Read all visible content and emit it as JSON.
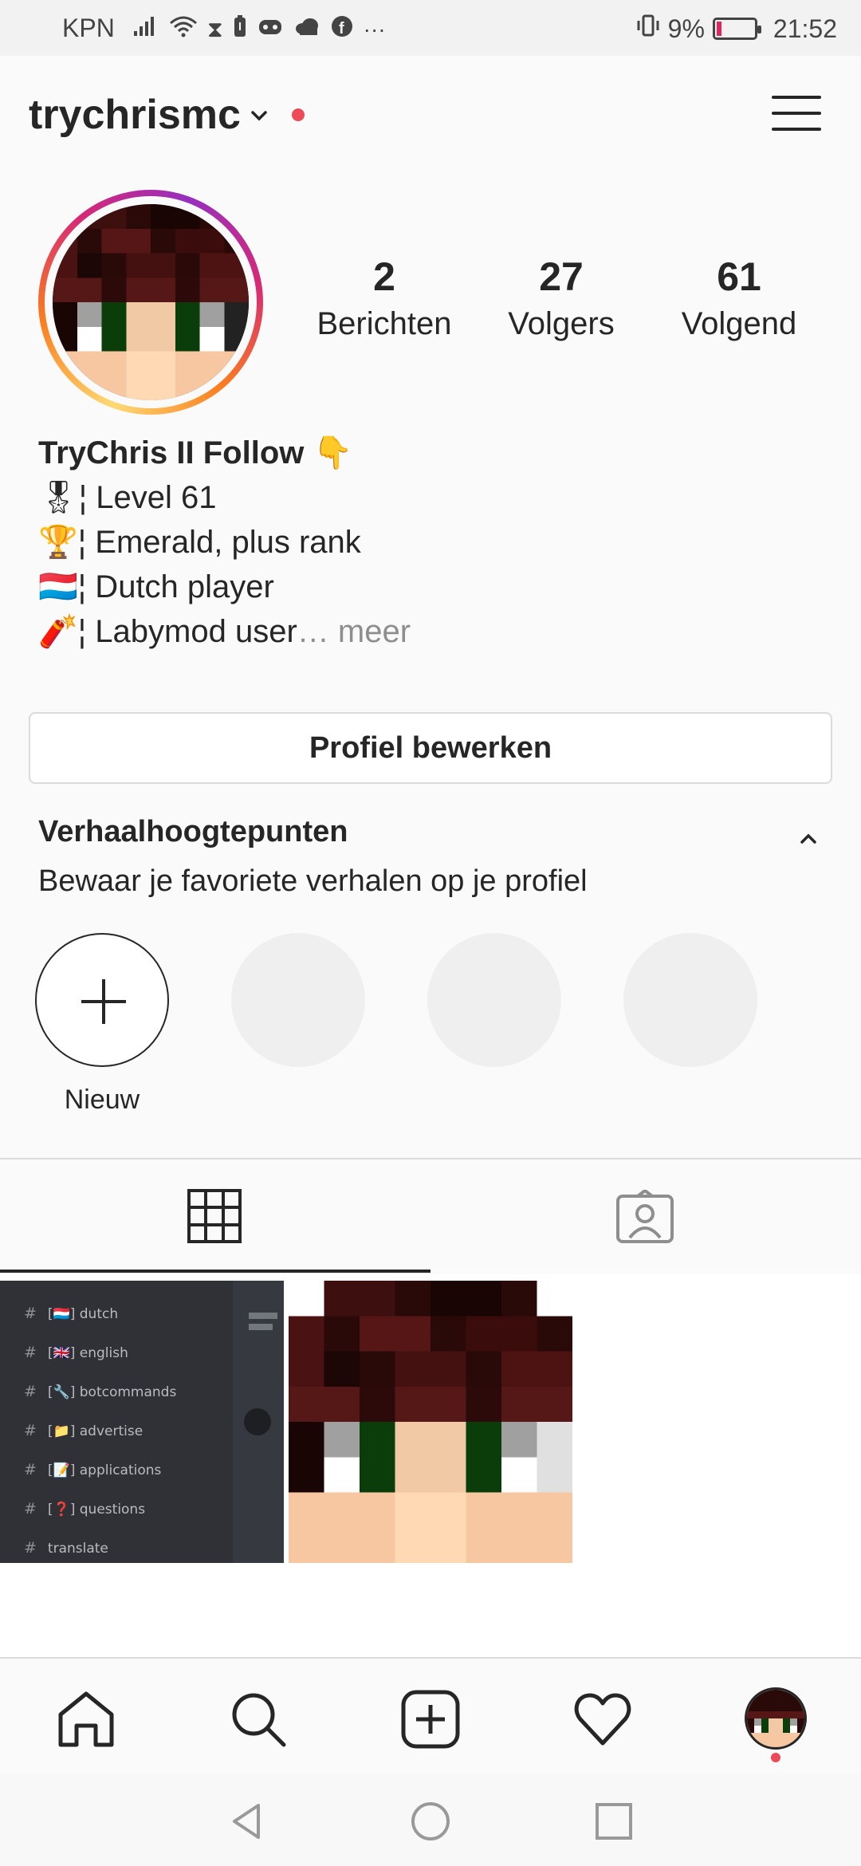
{
  "status_bar": {
    "carrier": "KPN",
    "icons": [
      "signal-icon",
      "wifi-icon",
      "hourglass-icon",
      "battery-saver-icon",
      "game-icon",
      "cloud-icon",
      "facebook-icon",
      "more-icon"
    ],
    "battery": "9%",
    "time": "21:52"
  },
  "header": {
    "username": "trychrismc"
  },
  "stats": [
    {
      "value": "2",
      "label": "Berichten"
    },
    {
      "value": "27",
      "label": "Volgers"
    },
    {
      "value": "61",
      "label": "Volgend"
    }
  ],
  "bio": {
    "name": "TryChris II Follow 👇",
    "lines": [
      "🎖¦ Level 61",
      "🏆¦ Emerald, plus rank",
      "🇱🇺¦ Dutch player",
      "🧨¦ Labymod user"
    ],
    "more": "… meer"
  },
  "edit_profile_label": "Profiel bewerken",
  "highlights": {
    "title": "Verhaalhoogtepunten",
    "subtitle": "Bewaar je favoriete verhalen op je profiel",
    "new_label": "Nieuw"
  },
  "posts": {
    "channels": [
      {
        "flag": "[🇱🇺]",
        "name": "dutch"
      },
      {
        "flag": "[🇬🇧]",
        "name": "english"
      },
      {
        "flag": "[🔧]",
        "name": "botcommands"
      },
      {
        "flag": "[📁]",
        "name": "advertise"
      },
      {
        "flag": "[📝]",
        "name": "applications"
      },
      {
        "flag": "[❓]",
        "name": "questions"
      },
      {
        "flag": "",
        "name": "translate"
      }
    ]
  },
  "colors": {
    "accent_red": "#ed4956",
    "text": "#262626",
    "muted": "#8e8e8e"
  }
}
